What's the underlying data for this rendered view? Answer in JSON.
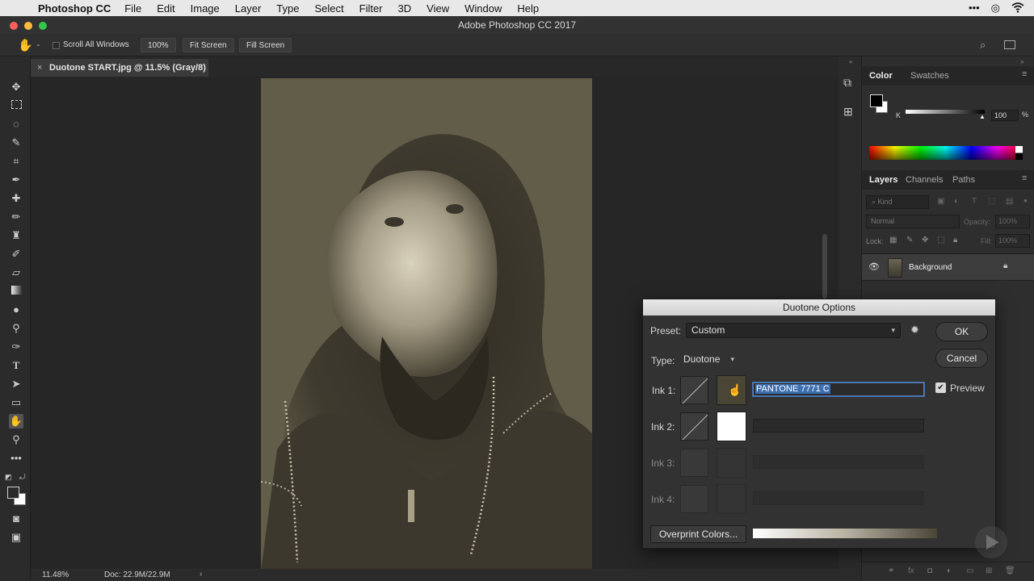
{
  "menubar": {
    "app": "Photoshop CC",
    "items": [
      "File",
      "Edit",
      "Image",
      "Layer",
      "Type",
      "Select",
      "Filter",
      "3D",
      "View",
      "Window",
      "Help"
    ]
  },
  "window": {
    "title": "Adobe Photoshop CC 2017"
  },
  "options": {
    "scroll_all": "Scroll All Windows",
    "zoom": "100%",
    "fit_screen": "Fit Screen",
    "fill_screen": "Fill Screen"
  },
  "document": {
    "tab_title": "Duotone START.jpg @ 11.5% (Gray/8)"
  },
  "status": {
    "zoom": "11.48%",
    "doc_size": "Doc: 22.9M/22.9M"
  },
  "color_panel": {
    "tabs": [
      "Color",
      "Swatches"
    ],
    "channel": "K",
    "value": "100",
    "unit": "%",
    "slider_fraction": 0.97
  },
  "layers_panel": {
    "tabs": [
      "Layers",
      "Channels",
      "Paths"
    ],
    "kind": "Kind",
    "blend_mode": "Normal",
    "opacity_label": "Opacity:",
    "opacity": "100%",
    "lock_label": "Lock:",
    "fill_label": "Fill:",
    "fill": "100%",
    "layer_name": "Background"
  },
  "dialog": {
    "title": "Duotone Options",
    "preset_label": "Preset:",
    "preset_value": "Custom",
    "type_label": "Type:",
    "type_value": "Duotone",
    "ok": "OK",
    "cancel": "Cancel",
    "preview": "Preview",
    "ink1_label": "Ink 1:",
    "ink1_name": "PANTONE 7771 C",
    "ink2_label": "Ink 2:",
    "ink3_label": "Ink 3:",
    "ink4_label": "Ink 4:",
    "overprint": "Overprint Colors...",
    "ink1_color": "#4a4535",
    "ink2_color": "#ffffff"
  },
  "colors": {
    "accent_selection": "#3d6fb0"
  }
}
